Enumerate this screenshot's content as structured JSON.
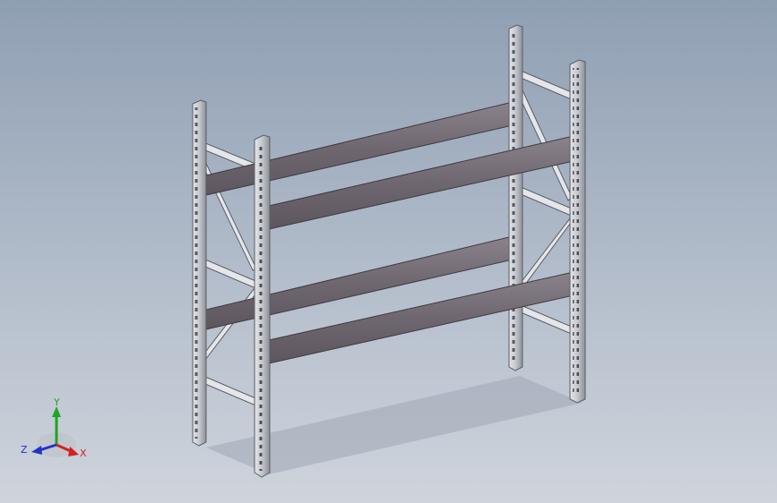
{
  "viewport": {
    "background_top": "#8f9fb3",
    "background_bottom": "#cfd4dc"
  },
  "model": {
    "name": "pallet-rack",
    "upright_count": 4,
    "beam_levels": 2,
    "colors": {
      "beam": "#6f6770",
      "beam_highlight": "#8b838c",
      "upright_front": "#b9bcc2",
      "upright_side": "#d9dbe0",
      "upright_edge": "#5c5e66",
      "brace": "#e4e6ea",
      "shadow": "#9aa3b0"
    }
  },
  "triad": {
    "x_label": "X",
    "y_label": "Y",
    "z_label": "Z",
    "x_color": "#d42020",
    "y_color": "#1fa51f",
    "z_color": "#2233c8"
  }
}
